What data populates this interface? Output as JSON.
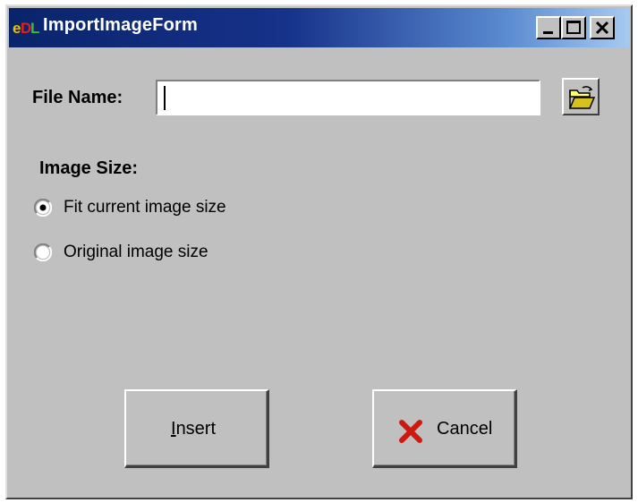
{
  "window": {
    "title": "ImportImageForm",
    "controls": [
      "minimize",
      "maximize",
      "close"
    ]
  },
  "file": {
    "label": "File Name:",
    "value": "",
    "browse_icon": "open-folder-icon"
  },
  "image_size": {
    "label": "Image Size:",
    "options": [
      {
        "label": "Fit current image size",
        "selected": true
      },
      {
        "label": "Original image size",
        "selected": false
      }
    ]
  },
  "buttons": {
    "insert_first": "I",
    "insert_rest": "nsert",
    "cancel": "Cancel",
    "cancel_icon": "red-x-icon"
  },
  "colors": {
    "titlebar_start": "#0a246a",
    "titlebar_end": "#a6caf0",
    "face": "#c0c0c0",
    "cancel_x": "#cc1a10"
  }
}
